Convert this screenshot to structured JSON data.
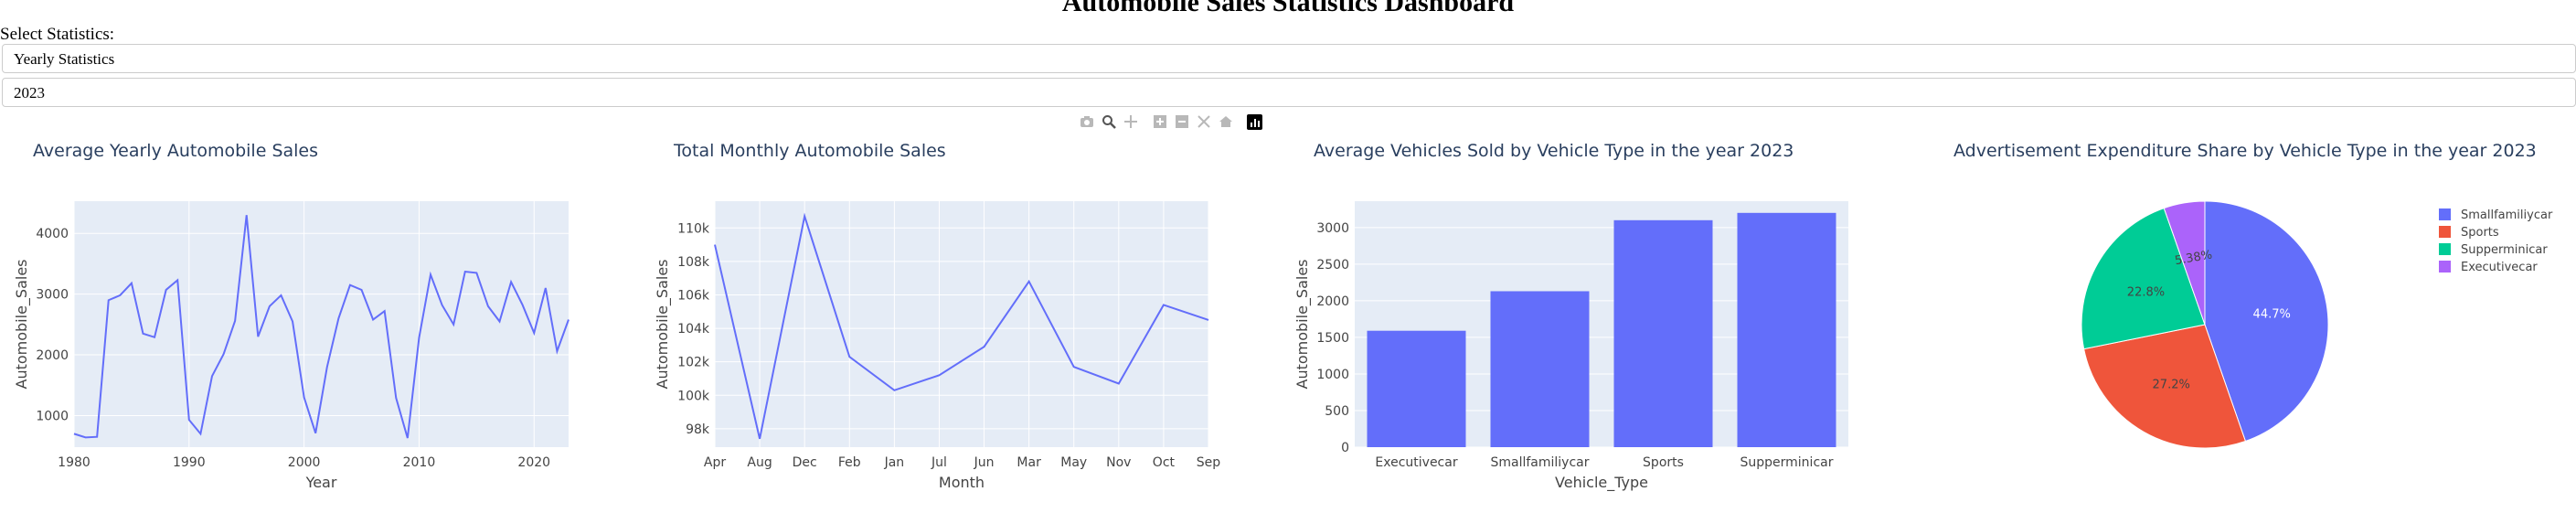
{
  "page": {
    "title": "Automobile Sales Statistics Dashboard",
    "select_label": "Select Statistics:",
    "statistics_dropdown": "Yearly Statistics",
    "year_dropdown": "2023"
  },
  "modebar": {
    "icons": [
      "camera-icon",
      "zoom-icon",
      "pan-icon",
      "zoom-in-icon",
      "zoom-out-icon",
      "autoscale-icon",
      "home-icon",
      "plotly-logo-icon"
    ]
  },
  "colors": {
    "plot_bg": "#e5ecf6",
    "blue": "#636efa",
    "red": "#ef553b",
    "green": "#00cc96",
    "purple": "#ab63fa",
    "title_text": "#2a3f5f",
    "axis_text": "#444444"
  },
  "chart_data": [
    {
      "type": "line",
      "title": "Average Yearly Automobile Sales",
      "xlabel": "Year",
      "ylabel": "Automobile_Sales",
      "xlim": [
        1980,
        2023
      ],
      "ylim": [
        480,
        4530
      ],
      "xticks": [
        1980,
        1990,
        2000,
        2010,
        2020
      ],
      "xtick_labels": [
        "1980",
        "1990",
        "2000",
        "2010",
        "2020"
      ],
      "yticks": [
        1000,
        2000,
        3000,
        4000
      ],
      "ytick_labels": [
        "1000",
        "2000",
        "3000",
        "4000"
      ],
      "x": [
        1980,
        1981,
        1982,
        1983,
        1984,
        1985,
        1986,
        1987,
        1988,
        1989,
        1990,
        1991,
        1992,
        1993,
        1994,
        1995,
        1996,
        1997,
        1998,
        1999,
        2000,
        2001,
        2002,
        2003,
        2004,
        2005,
        2006,
        2007,
        2008,
        2009,
        2010,
        2011,
        2012,
        2013,
        2014,
        2015,
        2016,
        2017,
        2018,
        2019,
        2020,
        2021,
        2022,
        2023
      ],
      "values": [
        700,
        640,
        650,
        2900,
        2980,
        3180,
        2350,
        2290,
        3070,
        3230,
        930,
        700,
        1650,
        2010,
        2560,
        4300,
        2300,
        2800,
        2980,
        2550,
        1300,
        710,
        1800,
        2600,
        3150,
        3070,
        2580,
        2720,
        1290,
        630,
        2280,
        3320,
        2820,
        2500,
        3370,
        3350,
        2800,
        2550,
        3200,
        2820,
        2360,
        3100,
        2060,
        2580
      ],
      "grid": true
    },
    {
      "type": "line",
      "title": "Total Monthly Automobile Sales",
      "xlabel": "Month",
      "ylabel": "Automobile_Sales",
      "categories": [
        "Apr",
        "Aug",
        "Dec",
        "Feb",
        "Jan",
        "Jul",
        "Jun",
        "Mar",
        "May",
        "Nov",
        "Oct",
        "Sep"
      ],
      "values": [
        109000,
        97400,
        110700,
        102300,
        100300,
        101200,
        102900,
        106800,
        101700,
        100700,
        105400,
        104500
      ],
      "ylim": [
        96900,
        111600
      ],
      "yticks": [
        98000,
        100000,
        102000,
        104000,
        106000,
        108000,
        110000
      ],
      "ytick_labels": [
        "98k",
        "100k",
        "102k",
        "104k",
        "106k",
        "108k",
        "110k"
      ],
      "grid": true
    },
    {
      "type": "bar",
      "title": "Average Vehicles Sold by Vehicle Type in the year 2023",
      "xlabel": "Vehicle_Type",
      "ylabel": "Automobile_Sales",
      "categories": [
        "Executivecar",
        "Smallfamiliycar",
        "Sports",
        "Supperminicar"
      ],
      "values": [
        1590,
        2130,
        3100,
        3200
      ],
      "ylim": [
        0,
        3360
      ],
      "yticks": [
        0,
        500,
        1000,
        1500,
        2000,
        2500,
        3000
      ],
      "ytick_labels": [
        "0",
        "500",
        "1000",
        "1500",
        "2000",
        "2500",
        "3000"
      ],
      "grid": true
    },
    {
      "type": "pie",
      "title": "Advertisement Expenditure Share by Vehicle Type in the year 2023",
      "labels": [
        "Smallfamiliycar",
        "Sports",
        "Supperminicar",
        "Executivecar"
      ],
      "values": [
        44.7,
        27.2,
        22.8,
        5.38
      ],
      "value_labels": [
        "44.7%",
        "27.2%",
        "22.8%",
        "5.38%"
      ],
      "colors": [
        "#636efa",
        "#ef553b",
        "#00cc96",
        "#ab63fa"
      ],
      "legend": "top-right"
    }
  ]
}
